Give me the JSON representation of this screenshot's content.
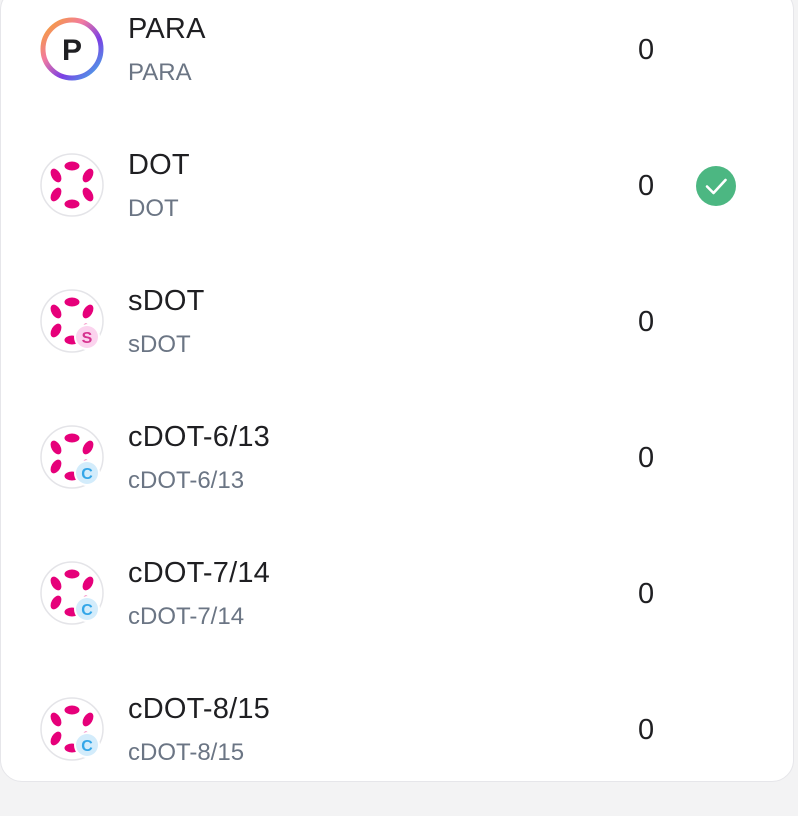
{
  "token_list": {
    "tokens": [
      {
        "symbol": "PARA",
        "subtitle": "PARA",
        "balance": "0",
        "logo": "para-logo",
        "badge": "",
        "selected": false
      },
      {
        "symbol": "DOT",
        "subtitle": "DOT",
        "balance": "0",
        "logo": "polkadot-logo",
        "badge": "",
        "selected": true
      },
      {
        "symbol": "sDOT",
        "subtitle": "sDOT",
        "balance": "0",
        "logo": "polkadot-logo",
        "badge": "S",
        "selected": false
      },
      {
        "symbol": "cDOT-6/13",
        "subtitle": "cDOT-6/13",
        "balance": "0",
        "logo": "polkadot-logo",
        "badge": "C",
        "selected": false
      },
      {
        "symbol": "cDOT-7/14",
        "subtitle": "cDOT-7/14",
        "balance": "0",
        "logo": "polkadot-logo",
        "badge": "C",
        "selected": false
      },
      {
        "symbol": "cDOT-8/15",
        "subtitle": "cDOT-8/15",
        "balance": "0",
        "logo": "polkadot-logo",
        "badge": "C",
        "selected": false
      }
    ]
  },
  "colors": {
    "polkadot_pink": "#e6007a",
    "check_green": "#4cb782",
    "badge_s_bg": "#fbd3ee",
    "badge_s_fg": "#d6338f",
    "badge_c_bg": "#d3ecfb",
    "badge_c_fg": "#33a6e8"
  }
}
